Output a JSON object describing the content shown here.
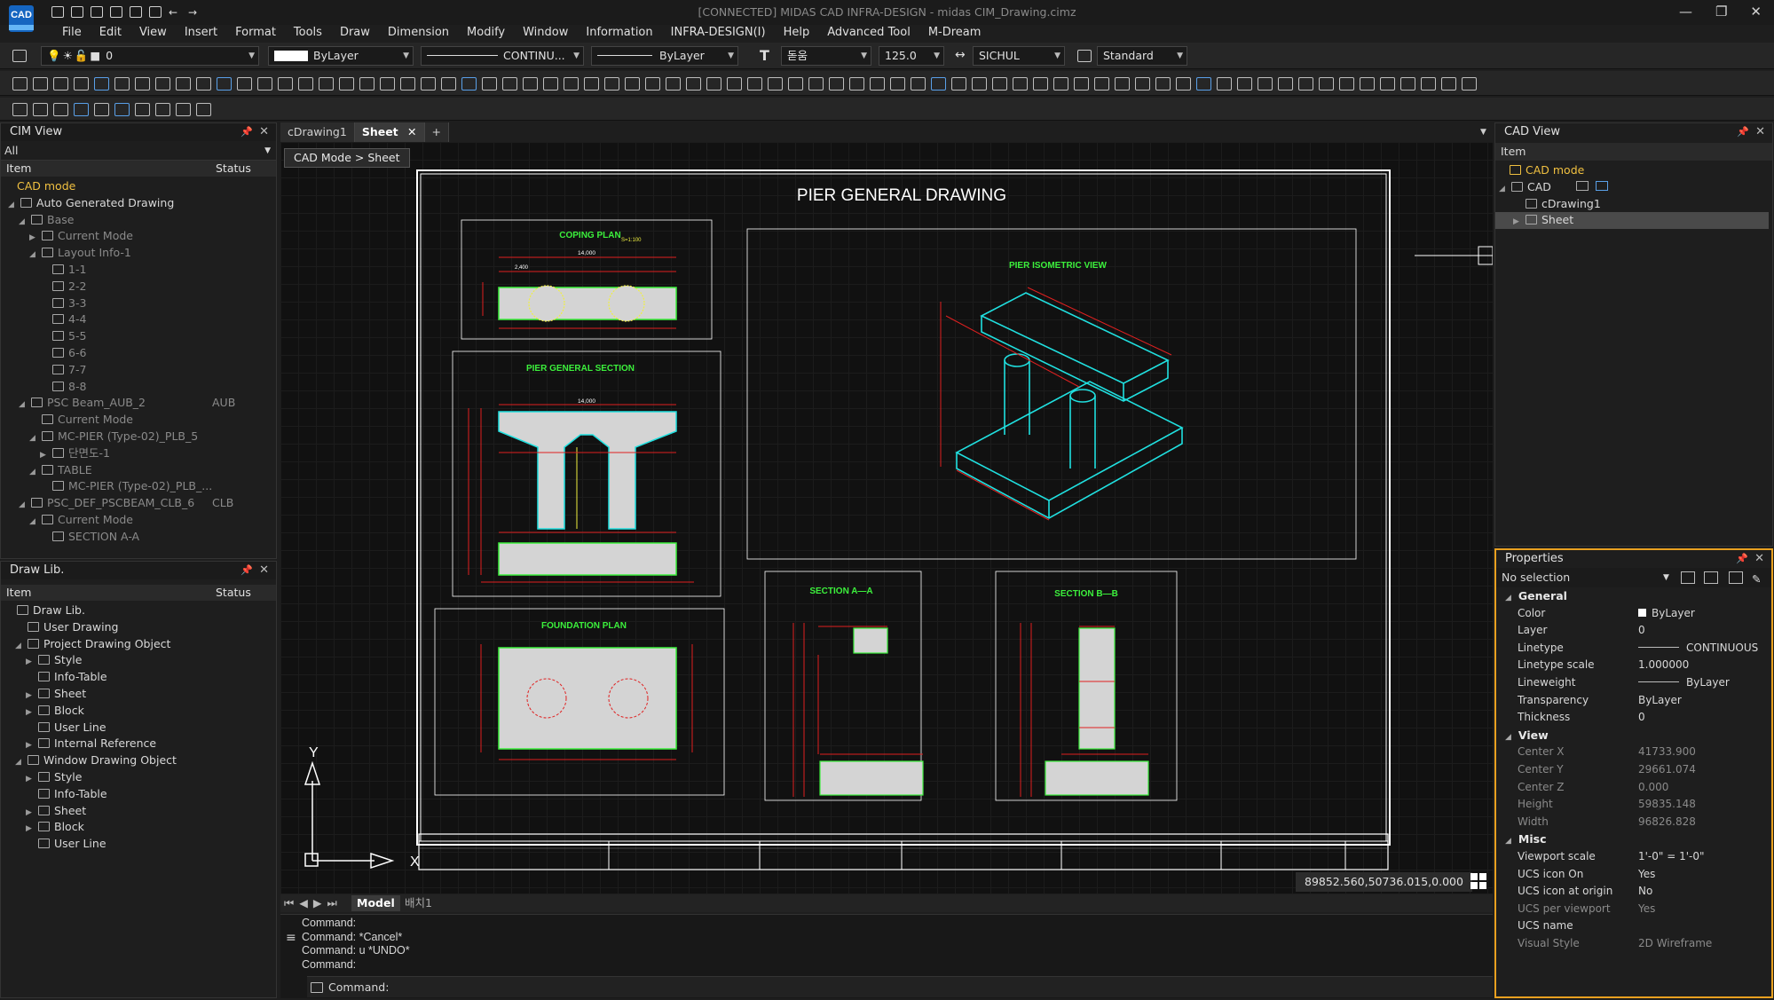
{
  "window": {
    "app_logo": "CAD",
    "title": "[CONNECTED] MIDAS CAD INFRA-DESIGN - midas CIM_Drawing.cimz",
    "minimize": "—",
    "restore": "❐",
    "close": "✕"
  },
  "menu": [
    "File",
    "Edit",
    "View",
    "Insert",
    "Format",
    "Tools",
    "Draw",
    "Dimension",
    "Modify",
    "Window",
    "Information",
    "INFRA-DESIGN(I)",
    "Help",
    "Advanced Tool",
    "M-Dream"
  ],
  "toolbar": {
    "layer_value": "0",
    "color_value": "ByLayer",
    "linetype_value": "CONTINU...",
    "lineweight_value": "ByLayer",
    "textstyle_value": "돋움",
    "textheight_value": "125.0",
    "dimstyle_value": "SICHUL",
    "tablestyle_value": "Standard"
  },
  "cim_view": {
    "title": "CIM View",
    "filter": "All",
    "col_item": "Item",
    "col_status": "Status",
    "rows": [
      {
        "label": "CAD mode",
        "status": ""
      },
      {
        "label": "Auto Generated Drawing",
        "status": ""
      },
      {
        "label": "Base",
        "status": ""
      },
      {
        "label": "Current Mode",
        "status": ""
      },
      {
        "label": "Layout Info-1",
        "status": ""
      },
      {
        "label": "1-1",
        "status": ""
      },
      {
        "label": "2-2",
        "status": ""
      },
      {
        "label": "3-3",
        "status": ""
      },
      {
        "label": "4-4",
        "status": ""
      },
      {
        "label": "5-5",
        "status": ""
      },
      {
        "label": "6-6",
        "status": ""
      },
      {
        "label": "7-7",
        "status": ""
      },
      {
        "label": "8-8",
        "status": ""
      },
      {
        "label": "PSC Beam_AUB_2",
        "status": "AUB"
      },
      {
        "label": "Current Mode",
        "status": ""
      },
      {
        "label": "MC-PIER (Type-02)_PLB_5",
        "status": ""
      },
      {
        "label": "단면도-1",
        "status": ""
      },
      {
        "label": "TABLE",
        "status": ""
      },
      {
        "label": "MC-PIER (Type-02)_PLB_...",
        "status": ""
      },
      {
        "label": "PSC_DEF_PSCBEAM_CLB_6",
        "status": "CLB"
      },
      {
        "label": "Current Mode",
        "status": ""
      },
      {
        "label": "SECTION A-A",
        "status": ""
      }
    ]
  },
  "draw_lib": {
    "title": "Draw Lib.",
    "col_item": "Item",
    "col_status": "Status",
    "rows": [
      "Draw Lib.",
      "User Drawing",
      "Project Drawing Object",
      "Style",
      "Info-Table",
      "Sheet",
      "Block",
      "User Line",
      "Internal Reference",
      "Window Drawing Object",
      "Style",
      "Info-Table",
      "Sheet",
      "Block",
      "User Line"
    ]
  },
  "tabs": [
    "cDrawing1",
    "Sheet"
  ],
  "tab_add": "+",
  "breadcrumb": "CAD Mode > Sheet",
  "drawing": {
    "title": "PIER GENERAL DRAWING",
    "coping_plan": "COPING PLAN",
    "isometric": "PIER ISOMETRIC VIEW",
    "general_section": "PIER GENERAL SECTION",
    "foundation": "FOUNDATION PLAN",
    "section_aa": "SECTION A—A",
    "section_bb": "SECTION B—B",
    "scale_note": "S=1:100",
    "dim_14000": "14,000",
    "dim_2400": "2,400",
    "ucs_y": "Y",
    "ucs_x": "X"
  },
  "coordinates": "89852.560,50736.015,0.000",
  "layout_tabs": {
    "model": "Model",
    "layout1": "배치1"
  },
  "command": {
    "history": [
      "Command:",
      "Command:  *Cancel*",
      "Command:  u *UNDO*",
      "Command:"
    ],
    "prompt": "Command:"
  },
  "cad_view": {
    "title": "CAD View",
    "col_item": "Item",
    "rows": [
      "CAD mode",
      "CAD",
      "cDrawing1",
      "Sheet"
    ]
  },
  "properties": {
    "title": "Properties",
    "selection": "No selection",
    "groups": [
      {
        "name": "General",
        "rows": [
          {
            "k": "Color",
            "v": "ByLayer"
          },
          {
            "k": "Layer",
            "v": "0"
          },
          {
            "k": "Linetype",
            "v": "CONTINUOUS"
          },
          {
            "k": "Linetype scale",
            "v": "1.000000"
          },
          {
            "k": "Lineweight",
            "v": "ByLayer"
          },
          {
            "k": "Transparency",
            "v": "ByLayer"
          },
          {
            "k": "Thickness",
            "v": "0"
          }
        ]
      },
      {
        "name": "View",
        "rows": [
          {
            "k": "Center X",
            "v": "41733.900"
          },
          {
            "k": "Center Y",
            "v": "29661.074"
          },
          {
            "k": "Center Z",
            "v": "0.000"
          },
          {
            "k": "Height",
            "v": "59835.148"
          },
          {
            "k": "Width",
            "v": "96826.828"
          }
        ]
      },
      {
        "name": "Misc",
        "rows": [
          {
            "k": "Viewport scale",
            "v": "1'-0\" = 1'-0\""
          },
          {
            "k": "UCS icon On",
            "v": "Yes"
          },
          {
            "k": "UCS icon at origin",
            "v": "No"
          },
          {
            "k": "UCS per viewport",
            "v": "Yes"
          },
          {
            "k": "UCS name",
            "v": ""
          },
          {
            "k": "Visual Style",
            "v": "2D Wireframe"
          }
        ]
      }
    ]
  },
  "colors": {
    "accent": "#e8a020",
    "cad_green": "#3cf03c",
    "cad_yellow": "#f0f040",
    "cad_red": "#e02020",
    "cad_cyan": "#20e0e0"
  }
}
